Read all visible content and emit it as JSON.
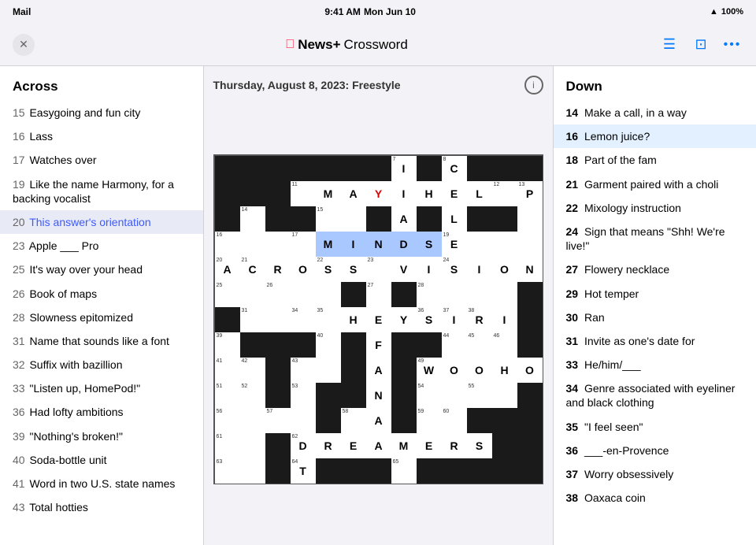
{
  "status_bar": {
    "left": "Mail",
    "time": "9:41 AM",
    "date": "Mon Jun 10",
    "wifi": "WiFi",
    "battery": "100%"
  },
  "toolbar": {
    "close_label": "✕",
    "app_name": "News+",
    "crossword_label": "Crossword",
    "dots": "•••"
  },
  "crossword_header": {
    "date_label": "Thursday, August 8, 2023: Freestyle",
    "info": "i"
  },
  "across": {
    "section_title": "Across",
    "clues": [
      {
        "number": "15",
        "text": "Easygoing and fun city"
      },
      {
        "number": "16",
        "text": "Lass"
      },
      {
        "number": "17",
        "text": "Watches over"
      },
      {
        "number": "19",
        "text": "Like the name Harmony, for a backing vocalist"
      },
      {
        "number": "20",
        "text": "This answer's orientation",
        "active": true
      },
      {
        "number": "23",
        "text": "Apple ___ Pro"
      },
      {
        "number": "25",
        "text": "It's way over your head"
      },
      {
        "number": "26",
        "text": "Book of maps"
      },
      {
        "number": "28",
        "text": "Slowness epitomized"
      },
      {
        "number": "31",
        "text": "Name that sounds like a font"
      },
      {
        "number": "32",
        "text": "Suffix with bazillion"
      },
      {
        "number": "33",
        "text": "\"Listen up, HomePod!\""
      },
      {
        "number": "36",
        "text": "Had lofty ambitions"
      },
      {
        "number": "39",
        "text": "\"Nothing's broken!\""
      },
      {
        "number": "40",
        "text": "Soda-bottle unit"
      },
      {
        "number": "41",
        "text": "Word in two U.S. state names"
      },
      {
        "number": "43",
        "text": "Total hotties"
      }
    ]
  },
  "down": {
    "section_title": "Down",
    "clues": [
      {
        "number": "14",
        "text": "Make a call, in a way"
      },
      {
        "number": "16",
        "text": "Lemon juice?",
        "active": true
      },
      {
        "number": "18",
        "text": "Part of the fam"
      },
      {
        "number": "21",
        "text": "Garment paired with a choli"
      },
      {
        "number": "22",
        "text": "Mixology instruction"
      },
      {
        "number": "24",
        "text": "Sign that means \"Shh! We're live!\""
      },
      {
        "number": "27",
        "text": "Flowery necklace"
      },
      {
        "number": "29",
        "text": "Hot temper"
      },
      {
        "number": "30",
        "text": "Ran"
      },
      {
        "number": "31",
        "text": "Invite as one's date for"
      },
      {
        "number": "33",
        "text": "He/him/___"
      },
      {
        "number": "34",
        "text": "Genre associated with eyeliner and black clothing"
      },
      {
        "number": "35",
        "text": "\"I feel seen\""
      },
      {
        "number": "36",
        "text": "___-en-Provence"
      },
      {
        "number": "37",
        "text": "Worry obsessively"
      },
      {
        "number": "38",
        "text": "Oaxaca coin"
      }
    ]
  },
  "grid": {
    "cols": 13,
    "rows": 13
  }
}
